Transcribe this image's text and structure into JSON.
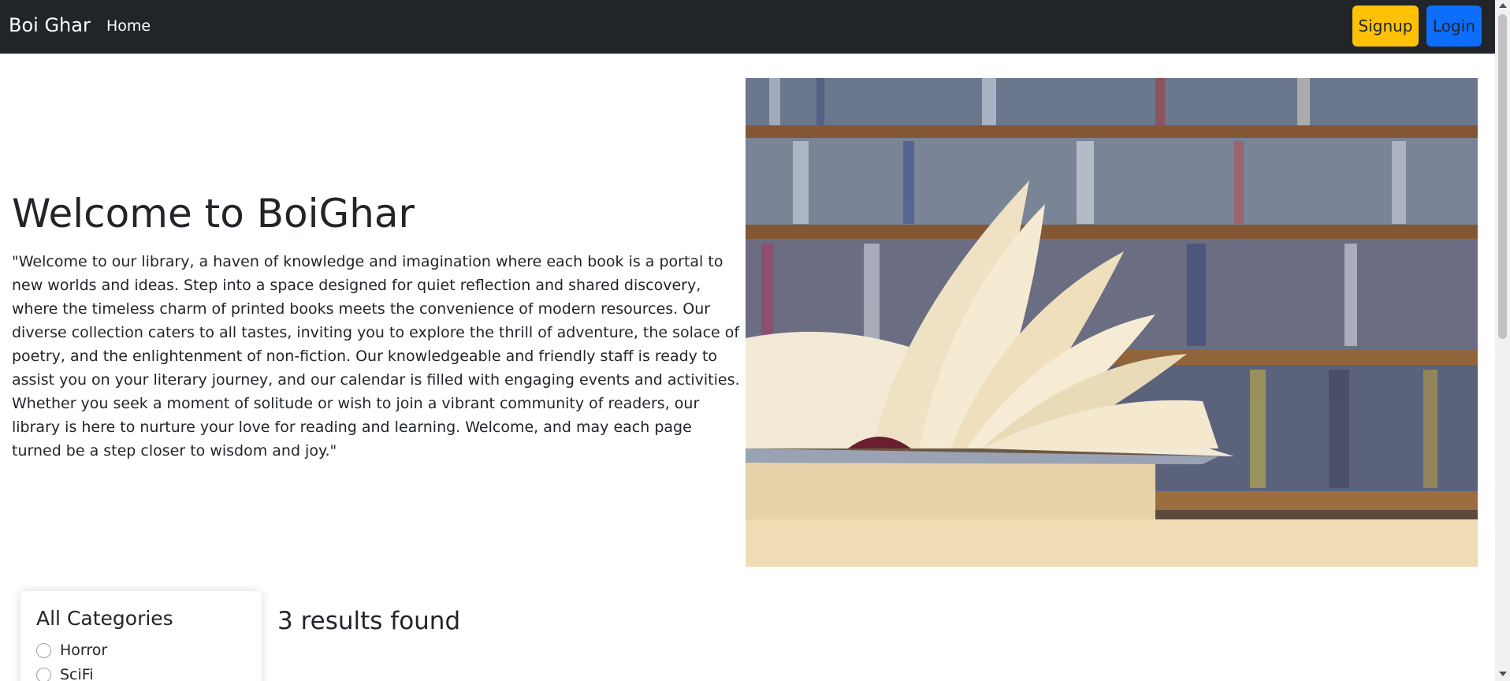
{
  "navbar": {
    "brand": "Boi Ghar",
    "home_label": "Home",
    "signup_label": "Signup",
    "login_label": "Login",
    "signup_color": "#ffc107",
    "login_color": "#0d6efd",
    "background": "#212529"
  },
  "hero": {
    "title": "Welcome to BoiGhar",
    "text": "\"Welcome to our library, a haven of knowledge and imagination where each book is a portal to new worlds and ideas. Step into a space designed for quiet reflection and shared discovery, where the timeless charm of printed books meets the convenience of modern resources. Our diverse collection caters to all tastes, inviting you to explore the thrill of adventure, the solace of poetry, and the enlightenment of non-fiction. Our knowledgeable and friendly staff is ready to assist you on your literary journey, and our calendar is filled with engaging events and activities. Whether you seek a moment of solitude or wish to join a vibrant community of readers, our library is here to nurture your love for reading and learning. Welcome, and may each page turned be a step closer to wisdom and joy.\"",
    "image_icon": "open-book-on-library-shelves-photo"
  },
  "sidebar": {
    "title": "All Categories",
    "categories": [
      {
        "label": "Horror",
        "checked": false
      },
      {
        "label": "SciFi",
        "checked": false
      }
    ]
  },
  "results": {
    "text": "3 results found"
  }
}
